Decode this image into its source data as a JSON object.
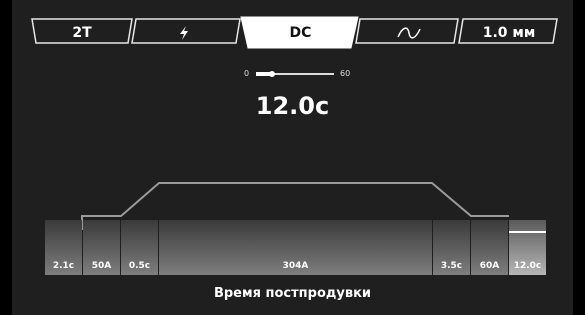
{
  "tabs": [
    {
      "label": "2T",
      "icon": null,
      "active": false
    },
    {
      "label": "",
      "icon": "lightning-icon",
      "active": false
    },
    {
      "label": "DC",
      "icon": null,
      "active": true
    },
    {
      "label": "",
      "icon": "sine-wave-icon",
      "active": false
    },
    {
      "label": "1.0 мм",
      "icon": null,
      "active": false
    }
  ],
  "slider": {
    "min": "0",
    "max": "60",
    "value_fraction": 0.2
  },
  "current_value": "12.0с",
  "segments": [
    {
      "label": "2.1с"
    },
    {
      "label": "50A"
    },
    {
      "label": "0.5с"
    },
    {
      "label": "304A"
    },
    {
      "label": "3.5с"
    },
    {
      "label": "60A"
    },
    {
      "label": "12.0с",
      "selected": true
    }
  ],
  "footer_label": "Время постпродувки",
  "colors": {
    "background": "#1f1f1f",
    "active_tab": "#ffffff",
    "line": "#9a9a9a",
    "accent": "#ffffff"
  }
}
